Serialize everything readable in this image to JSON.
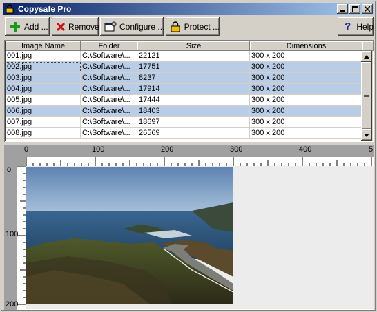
{
  "window": {
    "title": "Copysafe Pro"
  },
  "toolbar": {
    "add_label": "Add ...",
    "remove_label": "Remove",
    "configure_label": "Configure ...",
    "protect_label": "Protect ...",
    "help_label": "Help"
  },
  "grid": {
    "headers": [
      "Image Name",
      "Folder",
      "Size",
      "Dimensions"
    ],
    "rows": [
      {
        "name": "001.jpg",
        "folder": "C:\\Software\\...",
        "size": "22121",
        "dims": "300 x 200",
        "selected": false
      },
      {
        "name": "002.jpg",
        "folder": "C:\\Software\\...",
        "size": "17751",
        "dims": "300 x 200",
        "selected": true
      },
      {
        "name": "003.jpg",
        "folder": "C:\\Software\\...",
        "size": "8237",
        "dims": "300 x 200",
        "selected": true
      },
      {
        "name": "004.jpg",
        "folder": "C:\\Software\\...",
        "size": "17914",
        "dims": "300 x 200",
        "selected": true
      },
      {
        "name": "005.jpg",
        "folder": "C:\\Software\\...",
        "size": "17444",
        "dims": "300 x 200",
        "selected": false
      },
      {
        "name": "006.jpg",
        "folder": "C:\\Software\\...",
        "size": "18403",
        "dims": "300 x 200",
        "selected": true
      },
      {
        "name": "007.jpg",
        "folder": "C:\\Software\\...",
        "size": "18697",
        "dims": "300 x 200",
        "selected": false
      },
      {
        "name": "008.jpg",
        "folder": "C:\\Software\\...",
        "size": "26569",
        "dims": "300 x 200",
        "selected": false
      }
    ]
  },
  "preview": {
    "ruler_top_labels": [
      "0",
      "100",
      "200",
      "300",
      "400",
      "5"
    ],
    "ruler_left_labels": [
      "0",
      "100",
      "200"
    ]
  },
  "icons": {
    "add": "plus-icon",
    "remove": "red-x-icon",
    "configure": "configure-icon",
    "protect": "lock-icon",
    "help": "question-icon"
  }
}
